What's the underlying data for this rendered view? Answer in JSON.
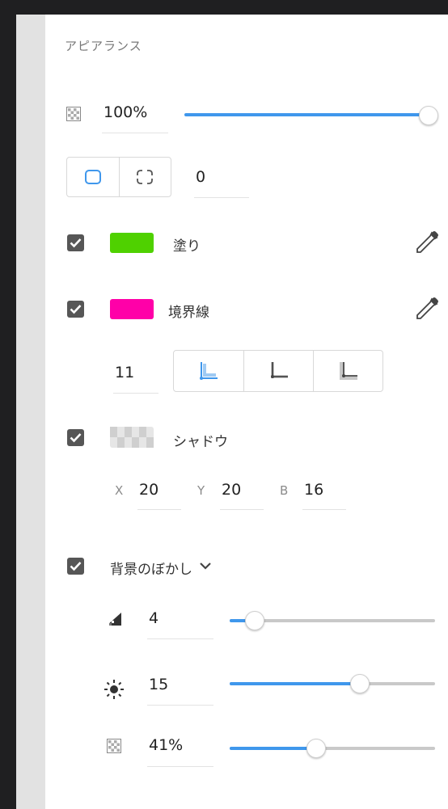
{
  "panel": {
    "title": "アピアランス",
    "opacity": {
      "value": "100%",
      "slider": 1.0
    },
    "corner": {
      "value": "0",
      "modes": [
        "corner-uniform-icon",
        "corner-individual-icon"
      ]
    },
    "fill": {
      "label": "塗り",
      "color": "#4fd100",
      "checked": true
    },
    "border": {
      "label": "境界線",
      "color": "#ff00a8",
      "checked": true,
      "width": "11",
      "alignments": [
        "border-inner-icon",
        "border-center-icon",
        "border-outer-icon"
      ]
    },
    "shadow": {
      "label": "シャドウ",
      "checked": true,
      "x_label": "X",
      "x": "20",
      "y_label": "Y",
      "y": "20",
      "b_label": "B",
      "b": "16"
    },
    "bg_blur": {
      "label": "背景のぼかし",
      "checked": true,
      "amount": {
        "value": "4",
        "slider": 0.13
      },
      "brightness": {
        "value": "15",
        "slider": 0.62
      },
      "opacity": {
        "value": "41%",
        "slider": 0.41
      }
    }
  },
  "colors": {
    "accent": "#3f97ec",
    "checkbox": "#565656"
  }
}
